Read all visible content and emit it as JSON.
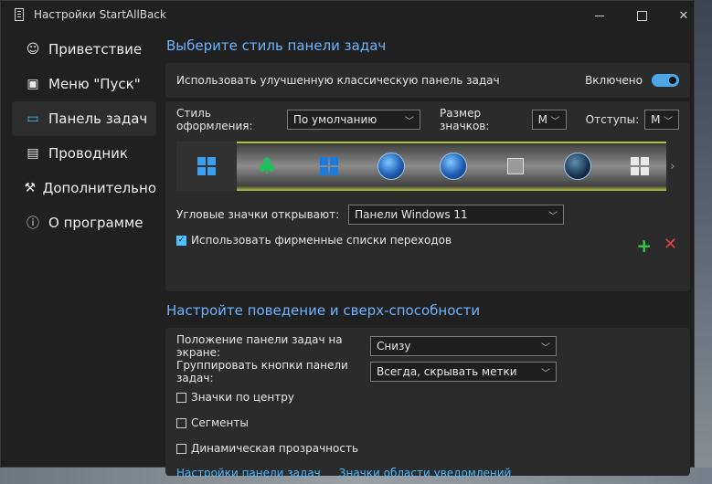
{
  "window": {
    "title": "Настройки StartAllBack"
  },
  "sidebar": {
    "items": [
      {
        "label": "Приветствие",
        "icon": "☺"
      },
      {
        "label": "Меню \"Пуск\"",
        "icon": "▣"
      },
      {
        "label": "Панель задач",
        "icon": "▭"
      },
      {
        "label": "Проводник",
        "icon": "▤"
      },
      {
        "label": "Дополнительно",
        "icon": "⚒"
      },
      {
        "label": "О программе",
        "icon": "ⓘ"
      }
    ]
  },
  "taskbar_style": {
    "section_title": "Выберите стиль панели задач",
    "enhanced_label": "Использовать улучшенную классическую панель задач",
    "enhanced_state": "Включено",
    "style_label": "Стиль оформления:",
    "style_value": "По умолчанию",
    "icon_size_label": "Размер значков:",
    "icon_size_value": "M",
    "padding_label": "Отступы:",
    "padding_value": "M",
    "corner_label": "Угловые значки открывают:",
    "corner_value": "Панели Windows 11",
    "jumplist_label": "Использовать фирменные списки переходов",
    "jumplist_checked": true
  },
  "behavior": {
    "section_title": "Настройте поведение и сверх-способности",
    "position_label": "Положение панели задач на экране:",
    "position_value": "Снизу",
    "group_label": "Группировать кнопки панели задач:",
    "group_value": "Всегда, скрывать метки",
    "checkboxes": [
      {
        "label": "Значки по центру",
        "checked": false
      },
      {
        "label": "Сегменты",
        "checked": false
      },
      {
        "label": "Динамическая прозрачность",
        "checked": false
      }
    ],
    "link1": "Настройки панели задач",
    "link2": "Значки области уведомлений"
  },
  "colors": {
    "accent": "#4cc2ff",
    "section_title": "#6db4ff",
    "link": "#4cb8ff"
  }
}
